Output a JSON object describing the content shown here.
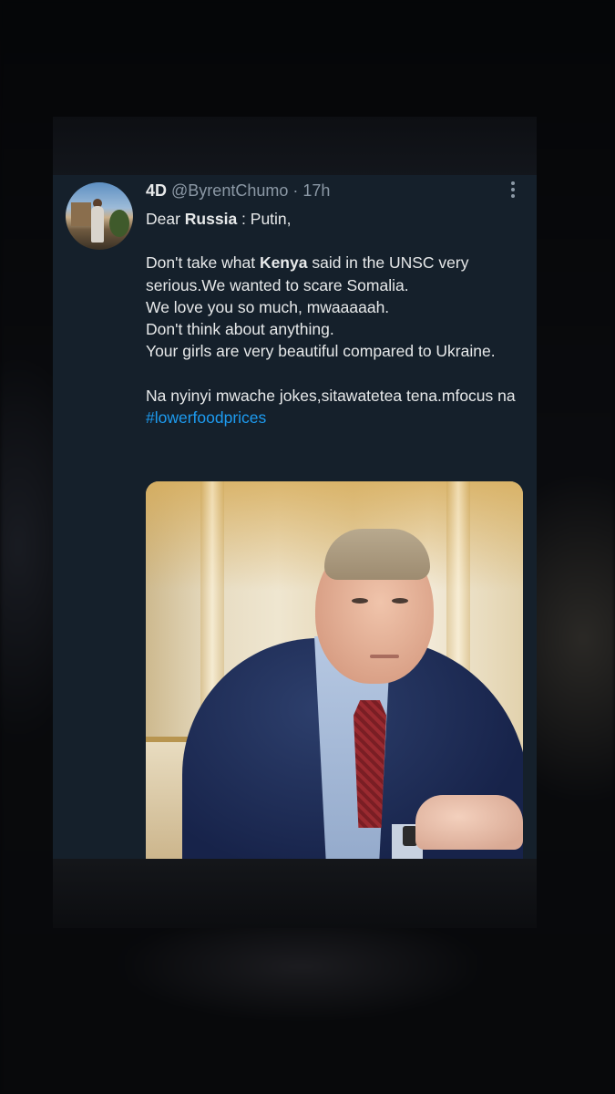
{
  "tweet": {
    "display_name": "4D",
    "handle": "@ByrentChumo",
    "separator": " · ",
    "time": "17h",
    "more_icon": "more-vertical-icon",
    "body": {
      "line1_prefix": "Dear ",
      "line1_bold": "Russia",
      "line1_suffix": " : Putin,",
      "para2_prefix": "Don't take what ",
      "para2_bold": "Kenya",
      "para2_rest": " said in the UNSC very serious.We wanted to scare Somalia.",
      "para2_line3": "We love you so much, mwaaaaah.",
      "para2_line4": "Don't think about anything.",
      "para2_line5": "Your girls are very beautiful compared to Ukraine.",
      "para3_text": "Na nyinyi mwache jokes,sitawatetea tena.mfocus na ",
      "hashtag": "#lowerfoodprices"
    },
    "hashtag_color": "#1d9bf0",
    "background_color": "#15202b"
  }
}
